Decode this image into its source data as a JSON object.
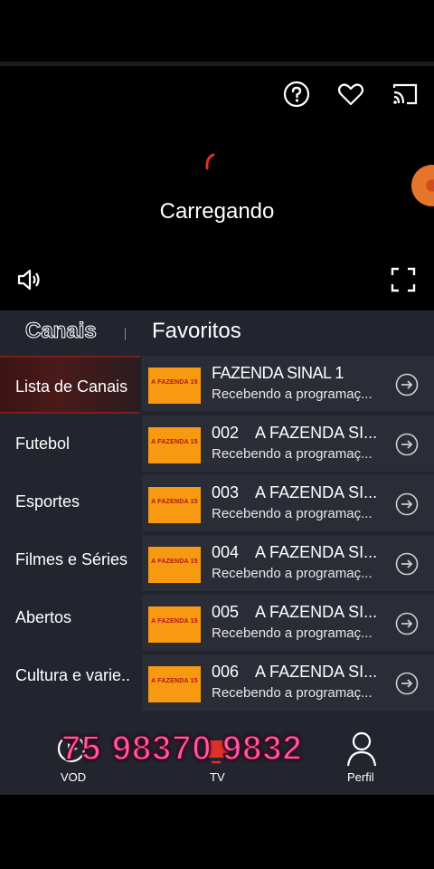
{
  "player": {
    "loading_text": "Carregando",
    "icons": [
      "help-icon",
      "heart-icon",
      "cast-icon",
      "volume-icon",
      "fullscreen-icon"
    ]
  },
  "tabs": {
    "channels": "Canais",
    "favorites": "Favoritos"
  },
  "categories": [
    {
      "label": "Lista de Canais",
      "active": true
    },
    {
      "label": "Futebol"
    },
    {
      "label": "Esportes"
    },
    {
      "label": "Filmes e Séries"
    },
    {
      "label": "Abertos"
    },
    {
      "label": "Cultura e varie.."
    }
  ],
  "channels": [
    {
      "number": "",
      "name": "FAZENDA SINAL 1",
      "subtitle": "Recebendo a programaç...",
      "logo_text": "A FAZENDA 15"
    },
    {
      "number": "002",
      "name": "A FAZENDA SI...",
      "subtitle": "Recebendo a programaç...",
      "logo_text": "A FAZENDA 15"
    },
    {
      "number": "003",
      "name": "A FAZENDA SI...",
      "subtitle": "Recebendo a programaç...",
      "logo_text": "A FAZENDA 15"
    },
    {
      "number": "004",
      "name": "A FAZENDA SI...",
      "subtitle": "Recebendo a programaç...",
      "logo_text": "A FAZENDA 15"
    },
    {
      "number": "005",
      "name": "A FAZENDA SI...",
      "subtitle": "Recebendo a programaç...",
      "logo_text": "A FAZENDA 15"
    },
    {
      "number": "006",
      "name": "A FAZENDA SI...",
      "subtitle": "Recebendo a programaç...",
      "logo_text": "A FAZENDA 15"
    }
  ],
  "bottom_nav": {
    "vod": "VOD",
    "tv": "TV",
    "profile": "Perfil"
  },
  "overlay_phone": "75 98370 9832",
  "colors": {
    "accent_red": "#e0302a",
    "logo_orange": "#f79a12",
    "panel_bg": "#23252e",
    "row_bg": "#2b2d36"
  }
}
